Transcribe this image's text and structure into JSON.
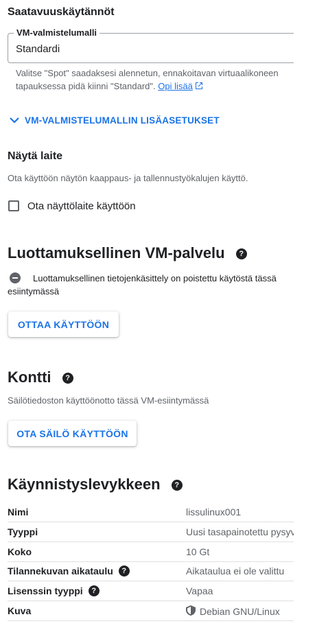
{
  "provisioning": {
    "title": "Saatavuuskäytännöt",
    "model_label": "VM-valmistelumalli",
    "model_value": "Standardi",
    "hint_line1": "Valitse \"Spot\" saadaksesi alennetun, ennakoitavan virtuaalikoneen",
    "hint_line2": "tapauksessa pidä kiinni \"Standard\".",
    "hint_link": "Opi lisää",
    "advanced_label": "VM-VALMISTELUMALLIN LISÄASETUKSET"
  },
  "display_device": {
    "title": "Näytä laite",
    "description": "Ota käyttöön näytön kaappaus- ja tallennustyökalujen käyttö.",
    "checkbox_label": "Ota näyttölaite käyttöön",
    "checked": false
  },
  "confidential": {
    "title": "Luottamuksellinen VM-palvelu",
    "notice_line1": "Luottamuksellinen tietojenkäsittely on poistettu käytöstä tässä",
    "notice_line2": "esiintymässä",
    "button_label": "OTTAA KÄYTTÖÖN"
  },
  "container": {
    "title": "Kontti",
    "description": "Säilötiedoston käyttöönotto tässä VM-esiintymässä",
    "button_label": "OTA SÄILÖ KÄYTTÖÖN"
  },
  "boot_disk": {
    "title": "Käynnistyslevykkeen",
    "rows": [
      {
        "key": "Nimi",
        "value": "lissulinux001"
      },
      {
        "key": "Tyyppi",
        "value": "Uusi tasapainotettu pysyvä levy"
      },
      {
        "key": "Koko",
        "value": "10 Gt"
      },
      {
        "key": "Tilannekuvan aikataulu",
        "value": "Aikataulua ei ole valittu"
      },
      {
        "key": "Lisenssin tyyppi",
        "value": "Vapaa"
      },
      {
        "key": "Kuva",
        "value": "Debian GNU/Linux"
      }
    ]
  },
  "colors": {
    "accent": "#1a73e8",
    "text": "#202124",
    "muted": "#5f6368"
  }
}
